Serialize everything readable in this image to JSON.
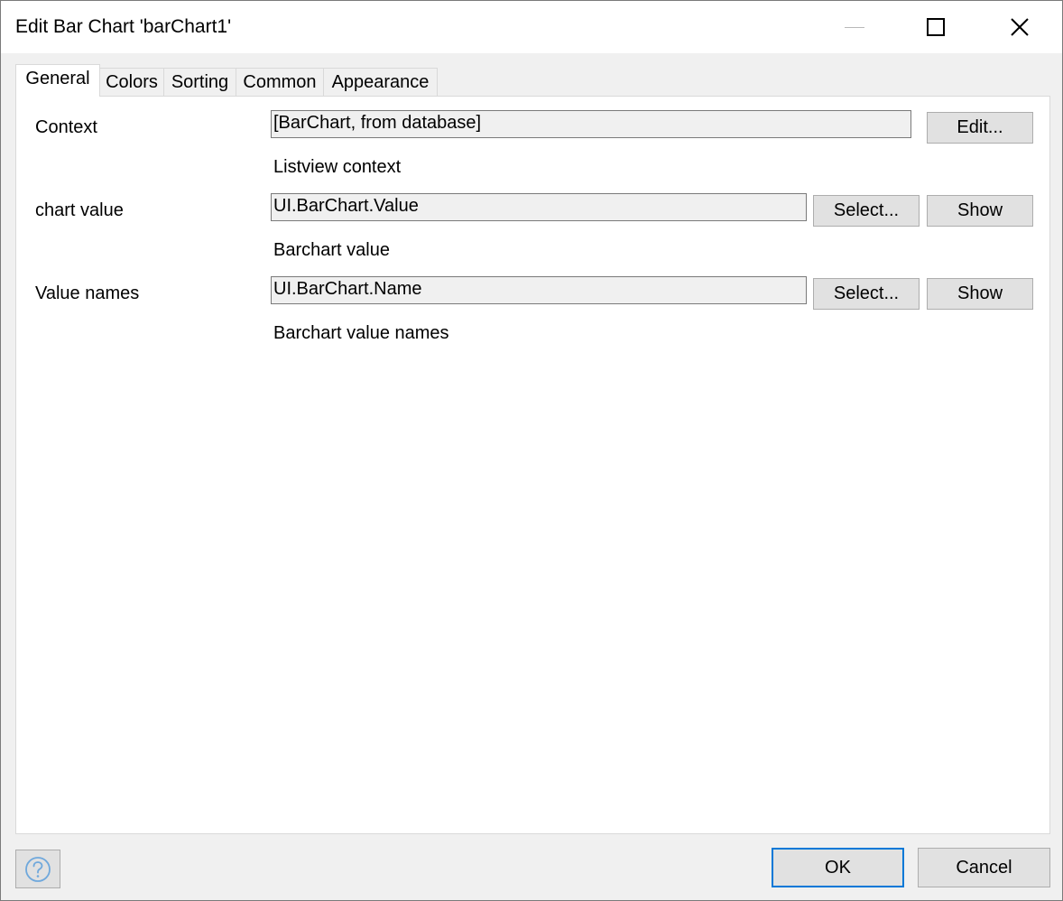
{
  "window": {
    "title": "Edit Bar Chart 'barChart1'"
  },
  "tabs": [
    {
      "label": "General",
      "active": true
    },
    {
      "label": "Colors"
    },
    {
      "label": "Sorting"
    },
    {
      "label": "Common"
    },
    {
      "label": "Appearance"
    }
  ],
  "general": {
    "context": {
      "label": "Context",
      "value": "[BarChart, from database]",
      "edit_label": "Edit...",
      "description": "Listview context"
    },
    "chart_value": {
      "label": "chart value",
      "value": "UI.BarChart.Value",
      "select_label": "Select...",
      "show_label": "Show",
      "description": "Barchart value"
    },
    "value_names": {
      "label": "Value names",
      "value": "UI.BarChart.Name",
      "select_label": "Select...",
      "show_label": "Show",
      "description": "Barchart value names"
    }
  },
  "footer": {
    "ok_label": "OK",
    "cancel_label": "Cancel",
    "help_icon": "question-circle"
  },
  "colors": {
    "accent": "#0078d7",
    "help_icon": "#6fa8dc"
  }
}
